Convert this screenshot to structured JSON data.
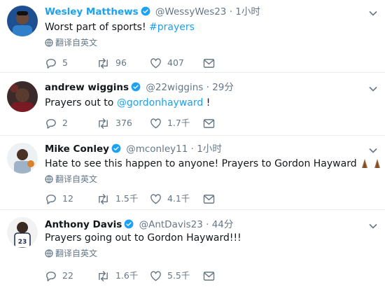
{
  "tweets": [
    {
      "name": "Wesley Matthews",
      "handle": "@WessyWes23",
      "sep": "·",
      "time": "1小时",
      "text_plain": "Worst part of sports! ",
      "text_link": "#prayers",
      "translate": "翻译自英文",
      "replies": "5",
      "retweets": "96",
      "likes": "407"
    },
    {
      "name": "andrew wiggins",
      "handle": "@22wiggins",
      "sep": "·",
      "time": "29分",
      "text_plain": "Prayers out to ",
      "text_link": "@gordonhayward",
      "text_after": " !",
      "replies": "2",
      "retweets": "376",
      "likes": "1.7千"
    },
    {
      "name": "Mike Conley",
      "handle": "@mconley11",
      "sep": "·",
      "time": "1小时",
      "text_plain": "Hate to see this happen to anyone! Prayers to Gordon Hayward",
      "translate": "翻译自英文",
      "replies": "12",
      "retweets": "1.5千",
      "likes": "4.1千"
    },
    {
      "name": "Anthony Davis",
      "handle": "@AntDavis23",
      "sep": "·",
      "time": "44分",
      "text_plain": "Prayers going out to Gordon Hayward!!!",
      "translate": "翻译自英文",
      "replies": "22",
      "retweets": "1.6千",
      "likes": "5.5千"
    }
  ],
  "icons": {
    "verified": "verified-badge-icon",
    "reply": "reply-icon",
    "retweet": "retweet-icon",
    "like": "heart-icon",
    "message": "direct-message-icon",
    "globe": "globe-icon",
    "chevron": "chevron-down-icon"
  },
  "colors": {
    "link": "#1da1f2",
    "muted": "#657786",
    "text": "#14171a",
    "divider": "#e6ecf0"
  }
}
